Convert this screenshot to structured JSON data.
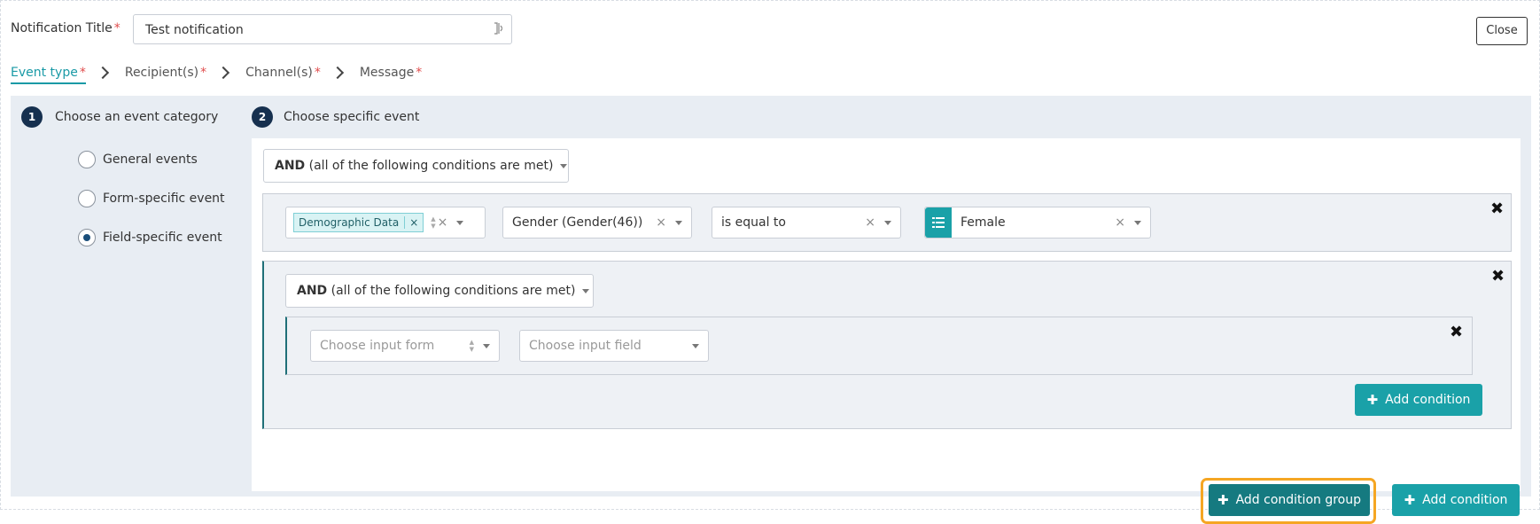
{
  "title": {
    "label": "Notification Title",
    "required_mark": "*",
    "value": "Test notification"
  },
  "close_label": "Close",
  "steps": [
    {
      "label": "Event type",
      "required_mark": "*",
      "active": true
    },
    {
      "label": "Recipient(s)",
      "required_mark": "*",
      "active": false
    },
    {
      "label": "Channel(s)",
      "required_mark": "*",
      "active": false
    },
    {
      "label": "Message",
      "required_mark": "*",
      "active": false
    }
  ],
  "section1": {
    "number": "1",
    "heading": "Choose an event category"
  },
  "section2": {
    "number": "2",
    "heading": "Choose specific event"
  },
  "categories": [
    {
      "label": "General events",
      "checked": false
    },
    {
      "label": "Form-specific event",
      "checked": false
    },
    {
      "label": "Field-specific event",
      "checked": true
    }
  ],
  "top_group": {
    "operator": "AND",
    "operator_desc": "(all of the following conditions are met)"
  },
  "condition1": {
    "tag_label": "Demographic Data",
    "tag_remove": "×",
    "clear_x": "×",
    "field": "Gender (Gender(46))",
    "comparator": "is equal to",
    "value": "Female"
  },
  "nested_group": {
    "operator": "AND",
    "operator_desc": "(all of the following conditions are met)",
    "form_placeholder": "Choose input form",
    "field_placeholder": "Choose input field",
    "add_condition_label": "Add condition"
  },
  "remove_icon": "✖",
  "add_condition_group_label": "Add condition group",
  "add_condition_label": "Add condition",
  "colors": {
    "accent": "#1aa1a8",
    "accent_dark": "#157a80",
    "highlight": "#f5a623",
    "step_badge": "#16304f"
  }
}
